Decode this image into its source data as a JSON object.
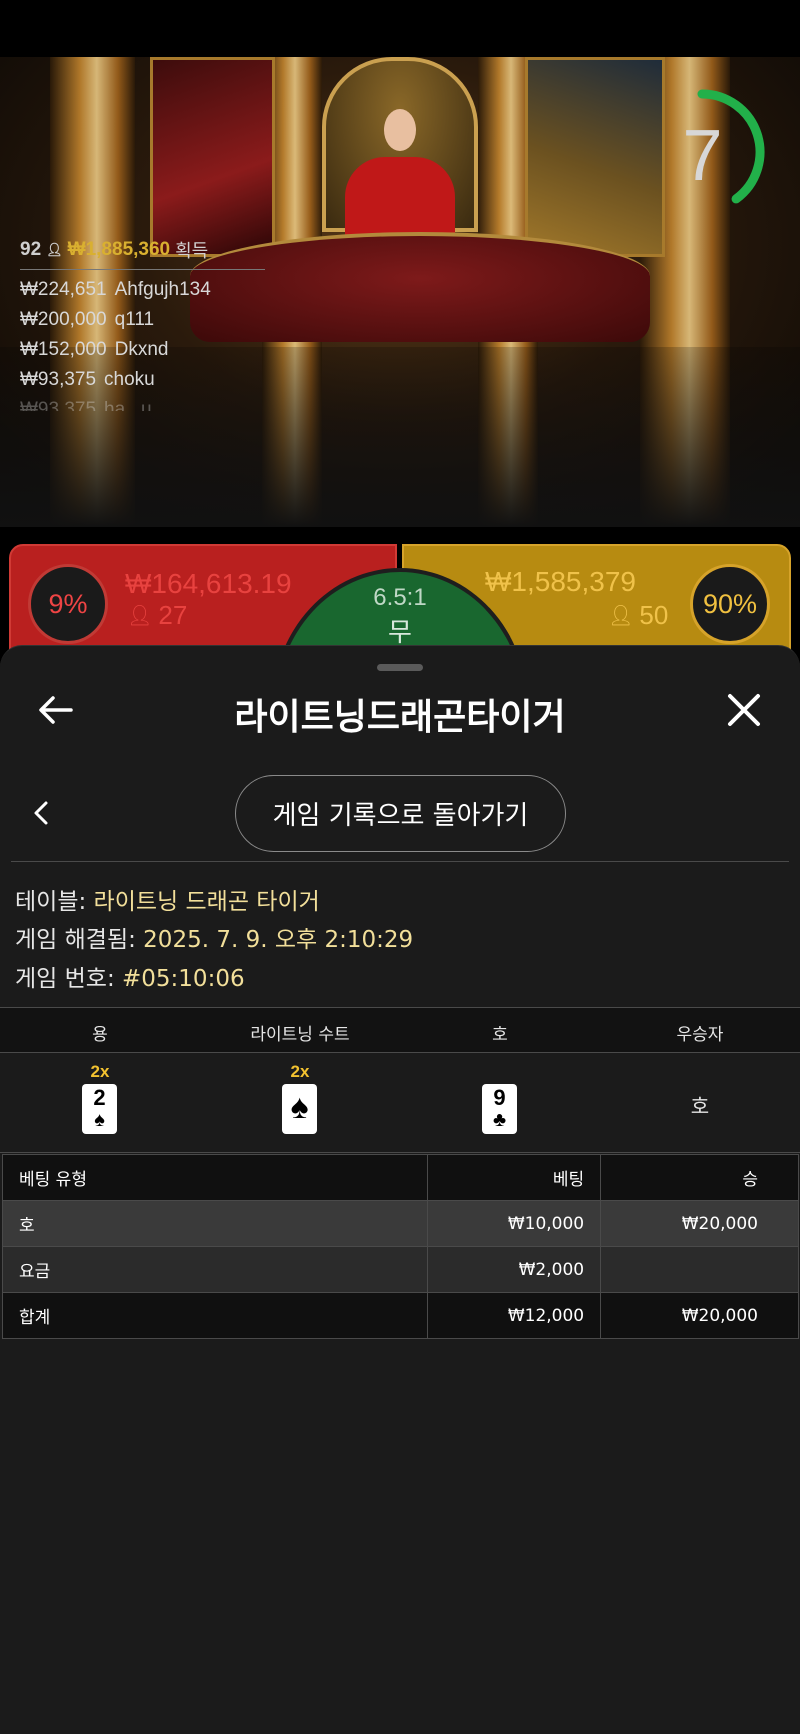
{
  "live": {
    "leaderboard": {
      "player_count": "92",
      "total_amount": "₩1,885,360",
      "label": "획득",
      "rows": [
        {
          "amount": "₩224,651",
          "name": "Ahfgujh134"
        },
        {
          "amount": "₩200,000",
          "name": "q111"
        },
        {
          "amount": "₩152,000",
          "name": "Dkxnd"
        },
        {
          "amount": "₩93,375",
          "name": "choku"
        },
        {
          "amount": "₩93,375",
          "name": "ha...u"
        }
      ]
    },
    "countdown": "7",
    "countdown_fraction": 0.4
  },
  "board": {
    "dragon": {
      "percent": "9%",
      "amount": "₩164,613.19",
      "players": "27",
      "color": "#b9201f"
    },
    "tie": {
      "ratio": "6.5:1",
      "label": "무",
      "color": "#19672f"
    },
    "tiger": {
      "percent": "90%",
      "amount": "₩1,585,379",
      "players": "50",
      "color": "#b78b11"
    }
  },
  "sheet": {
    "title": "라이트닝드래곤타이거",
    "history_button": "게임 기록으로 돌아가기",
    "info": {
      "table_label": "테이블: ",
      "table_value": "라이트닝 드래곤 타이거",
      "resolved_label": "게임 해결됨: ",
      "resolved_value": "2025. 7. 9. 오후 2:10:29",
      "number_label": "게임 번호: ",
      "number_value": "#05:10:06"
    },
    "cards": {
      "headers": [
        "용",
        "라이트닝 수트",
        "호",
        "우승자"
      ],
      "dragon": {
        "multiplier": "2x",
        "rank": "2",
        "suit": "♠"
      },
      "lightning": {
        "multiplier": "2x",
        "suit": "♠"
      },
      "tiger": {
        "rank": "9",
        "suit": "♣"
      },
      "winner": "호"
    },
    "bets": {
      "headers": [
        "베팅 유형",
        "베팅",
        "승"
      ],
      "rows": [
        [
          "호",
          "₩10,000",
          "₩20,000"
        ],
        [
          "요금",
          "₩2,000",
          ""
        ],
        [
          "합계",
          "₩12,000",
          "₩20,000"
        ]
      ]
    }
  },
  "icons": [
    "back-arrow-icon",
    "close-icon",
    "chevron-left-icon",
    "person-icon"
  ]
}
